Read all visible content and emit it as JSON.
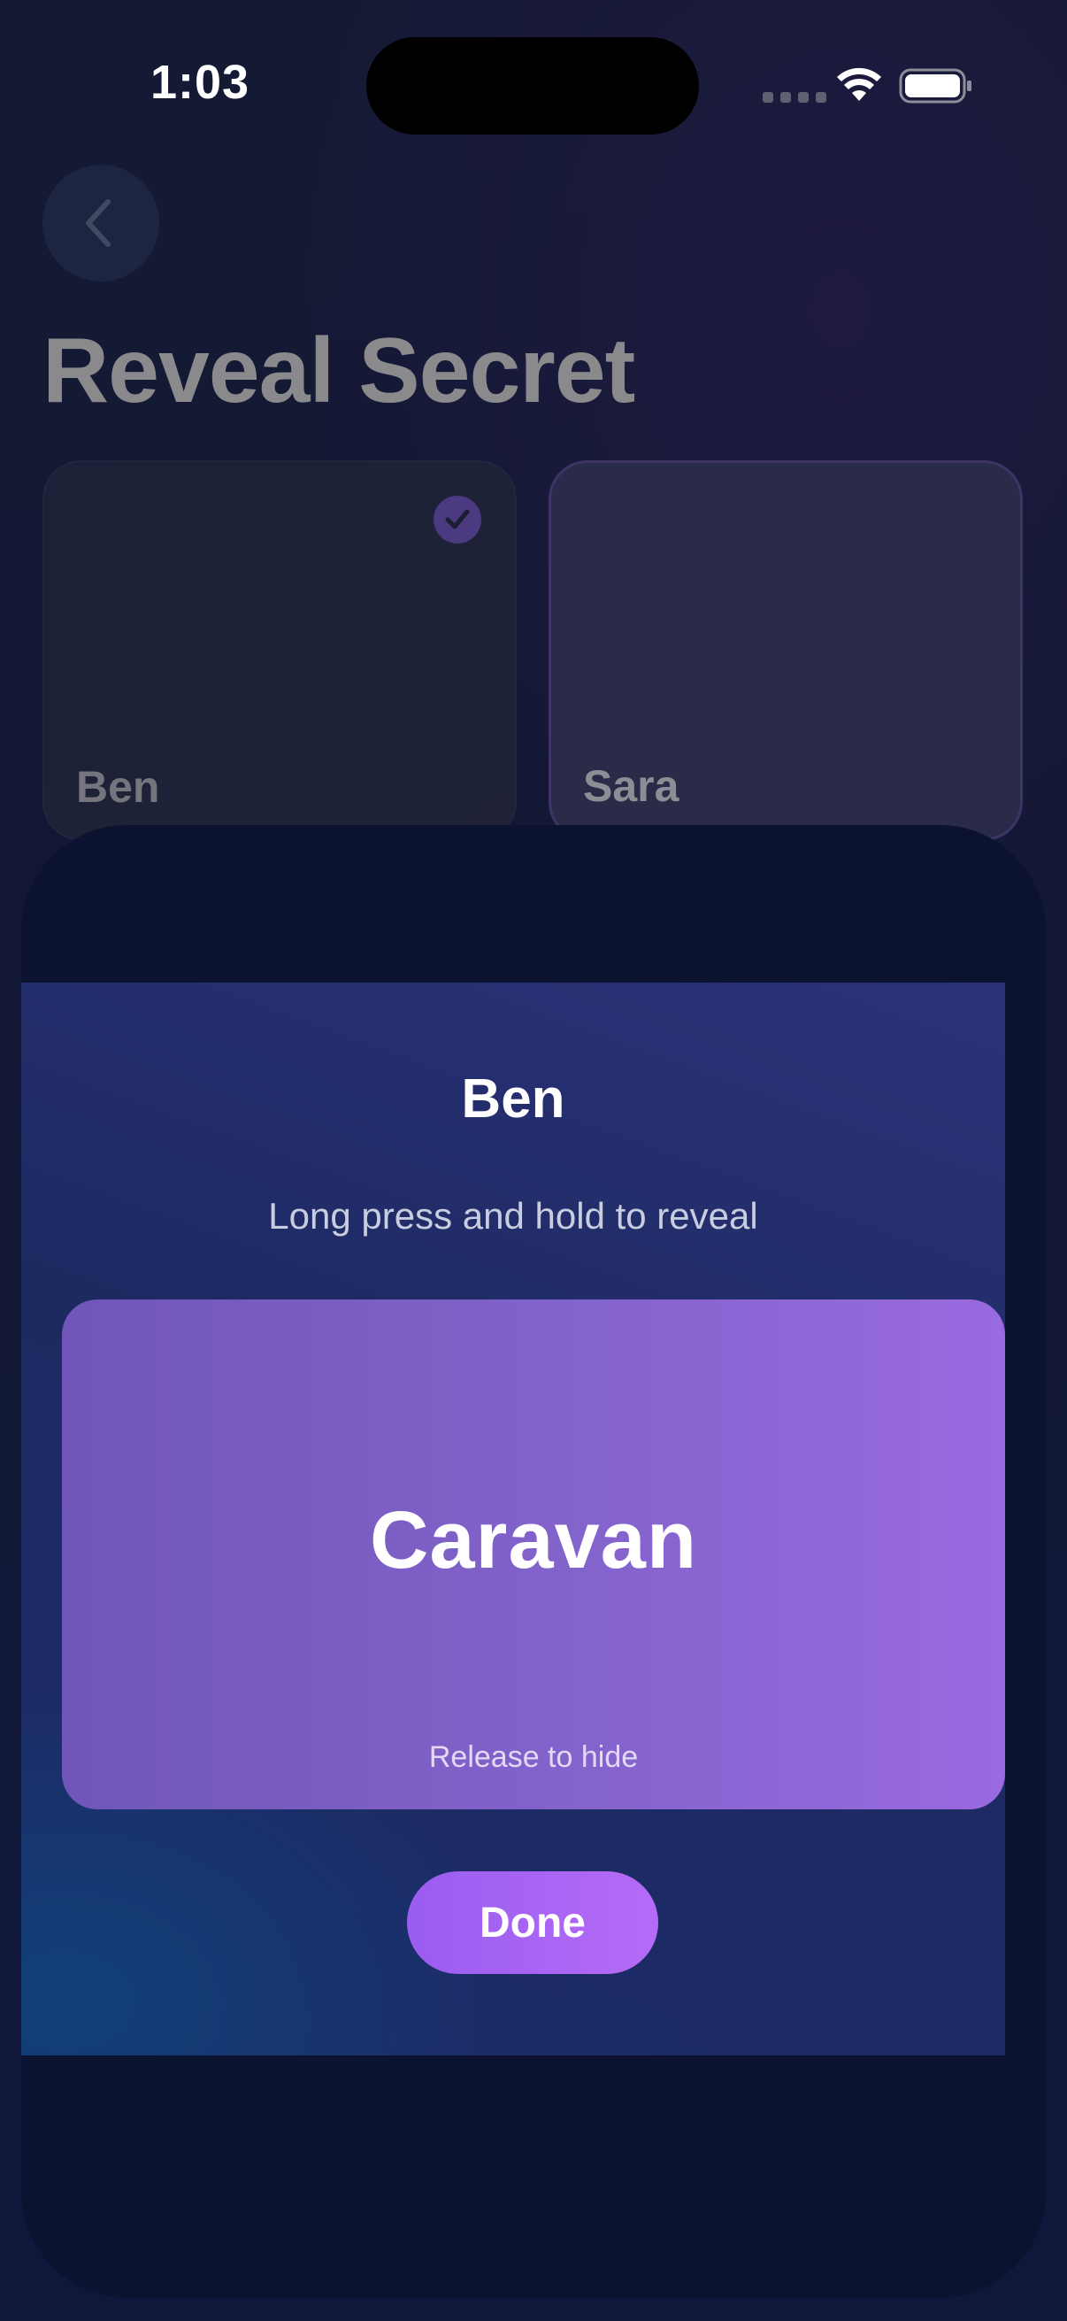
{
  "status_bar": {
    "time": "1:03"
  },
  "header": {
    "title": "Reveal Secret",
    "back_icon": "chevron-left-icon"
  },
  "players": [
    {
      "name": "Ben",
      "selected": true
    },
    {
      "name": "Sara",
      "selected": false
    }
  ],
  "sheet": {
    "player_name": "Ben",
    "instruction": "Long press and hold to reveal",
    "secret_word": "Caravan",
    "release_hint": "Release to hide",
    "done_label": "Done"
  },
  "colors": {
    "accent": "#9a5df0",
    "card": "#8363cc",
    "sheet": "#0c1330"
  }
}
